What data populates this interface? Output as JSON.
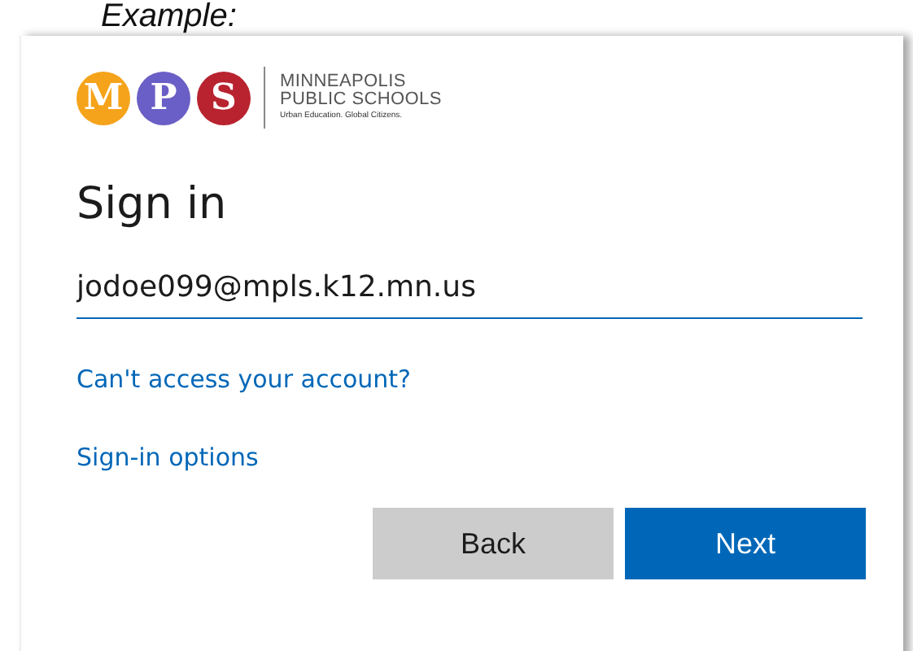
{
  "caption": "Example:",
  "logo": {
    "badges": [
      {
        "letter": "M",
        "color": "#f5a31a"
      },
      {
        "letter": "P",
        "color": "#6a5fc6"
      },
      {
        "letter": "S",
        "color": "#b8232f"
      }
    ],
    "name_lines": [
      "MINNEAPOLIS",
      "PUBLIC SCHOOLS"
    ],
    "tagline": "Urban Education. Global Citizens."
  },
  "title": "Sign in",
  "email_field": {
    "value": "jodoe099@mpls.k12.mn.us"
  },
  "links": [
    "Can't access your account?",
    "Sign-in options"
  ],
  "buttons": [
    {
      "label": "Back",
      "kind": "secondary"
    },
    {
      "label": "Next",
      "kind": "primary"
    }
  ]
}
